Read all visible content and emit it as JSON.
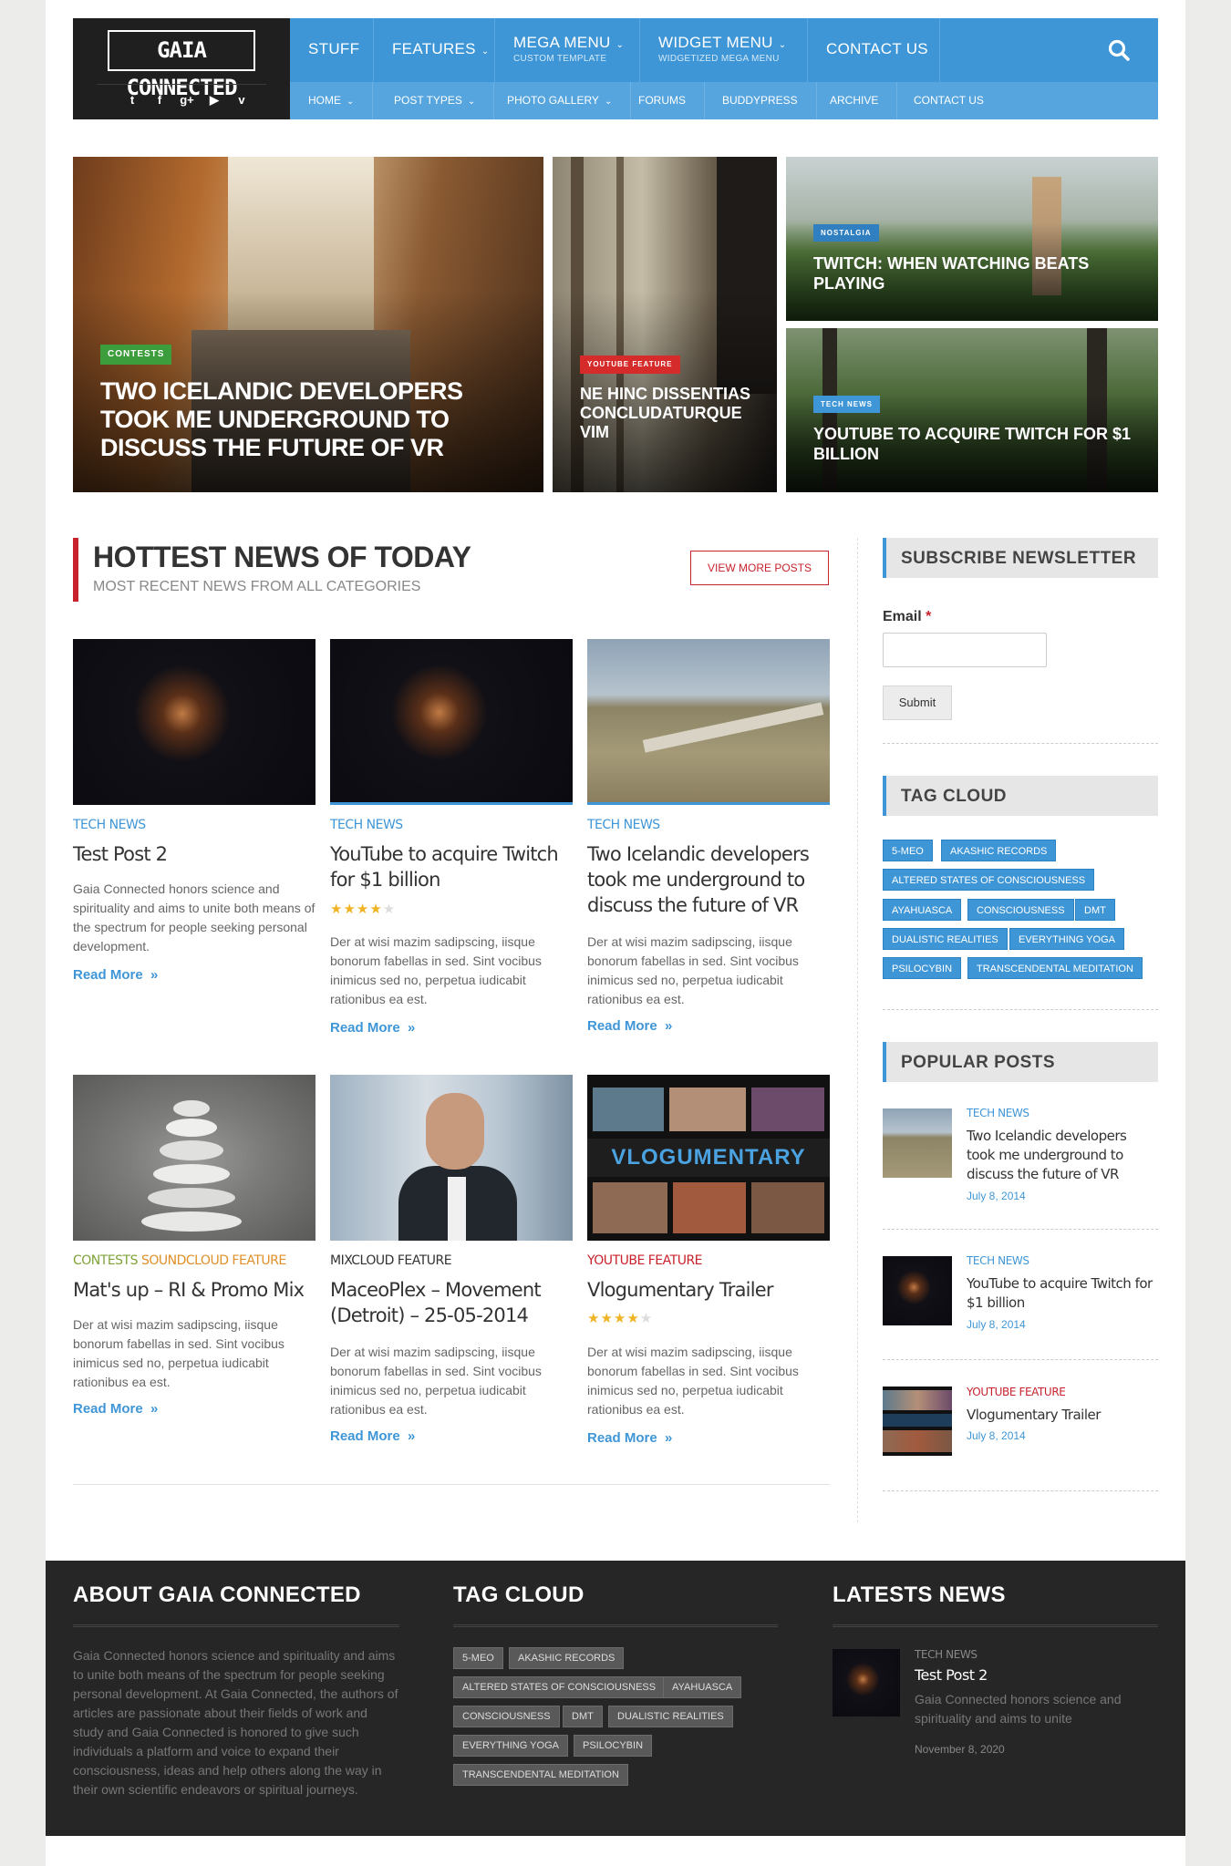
{
  "header": {
    "logo_text": "GAIA CONNECTED",
    "social_icons": [
      "twitter-icon",
      "facebook-icon",
      "google-plus-icon",
      "youtube-icon",
      "vimeo-icon"
    ],
    "social_glyphs": [
      "t",
      "f",
      "g+",
      "▶",
      "v"
    ],
    "main_nav": [
      {
        "label": "STUFF",
        "sub": ""
      },
      {
        "label": "FEATURES",
        "sub": ""
      },
      {
        "label": "MEGA MENU",
        "sub": "CUSTOM TEMPLATE"
      },
      {
        "label": "WIDGET MENU",
        "sub": "WIDGETIZED MEGA MENU"
      },
      {
        "label": "CONTACT US",
        "sub": ""
      }
    ],
    "sub_nav": [
      "HOME",
      "POST TYPES",
      "PHOTO GALLERY",
      "FORUMS",
      "BUDDYPRESS",
      "ARCHIVE",
      "CONTACT US"
    ],
    "search_icon": "search-icon"
  },
  "featured": [
    {
      "tag": "CONTESTS",
      "title": "TWO ICELANDIC DEVELOPERS TOOK ME UNDERGROUND TO DISCUSS THE FUTURE OF VR",
      "tag_color": "#3c9d3c"
    },
    {
      "tag": "YOUTUBE FEATURE",
      "title": "NE HINC DISSENTIAS CONCLUDATURQUE VIM",
      "tag_color": "#d52b2b"
    },
    {
      "tag": "NOSTALGIA",
      "title": "TWITCH: WHEN WATCHING BEATS PLAYING",
      "tag_color": "#2f7fc1"
    },
    {
      "tag": "TECH NEWS",
      "title": "YOUTUBE TO ACQUIRE TWITCH FOR $1 BILLION",
      "tag_color": "#3f96d6"
    }
  ],
  "hottest": {
    "title": "HOTTEST NEWS OF TODAY",
    "subtitle": "MOST RECENT NEWS FROM ALL CATEGORIES",
    "view_more": "VIEW MORE POSTS"
  },
  "posts": [
    {
      "cat": "TECH NEWS",
      "cat2": "",
      "title": "Test Post 2",
      "rating": null,
      "excerpt": "Gaia Connected honors science and spirituality and aims to unite both means of the spectrum for people seeking personal development.",
      "read_more": "Read More"
    },
    {
      "cat": "TECH NEWS",
      "cat2": "",
      "title": "YouTube to acquire Twitch for $1 billion",
      "rating": 4,
      "excerpt": "Der at wisi mazim sadipscing, iisque bonorum fabellas in sed. Sint vocibus inimicus sed no, perpetua iudicabit rationibus ea est.",
      "read_more": "Read More"
    },
    {
      "cat": "TECH NEWS",
      "cat2": "",
      "title": "Two Icelandic developers took me underground to discuss the future of VR",
      "rating": null,
      "excerpt": "Der at wisi mazim sadipscing, iisque bonorum fabellas in sed. Sint vocibus inimicus sed no, perpetua iudicabit rationibus ea est.",
      "read_more": "Read More"
    },
    {
      "cat": "CONTESTS",
      "cat2": "SOUNDCLOUD FEATURE",
      "title": "Mat's up – RI & Promo Mix",
      "rating": null,
      "excerpt": "Der at wisi mazim sadipscing, iisque bonorum fabellas in sed. Sint vocibus inimicus sed no, perpetua iudicabit rationibus ea est.",
      "read_more": "Read More"
    },
    {
      "cat": "MIXCLOUD FEATURE",
      "cat2": "",
      "title": "MaceoPlex – Movement (Detroit) – 25-05-2014",
      "rating": null,
      "excerpt": "Der at wisi mazim sadipscing, iisque bonorum fabellas in sed. Sint vocibus inimicus sed no, perpetua iudicabit rationibus ea est.",
      "read_more": "Read More"
    },
    {
      "cat": "YOUTUBE FEATURE",
      "cat2": "",
      "title": "Vlogumentary Trailer",
      "rating": 4,
      "excerpt": "Der at wisi mazim sadipscing, iisque bonorum fabellas in sed. Sint vocibus inimicus sed no, perpetua iudicabit rationibus ea est.",
      "read_more": "Read More"
    }
  ],
  "vlog_banner": "VLOGUMENTARY",
  "sidebar": {
    "newsletter_title": "SUBSCRIBE NEWSLETTER",
    "email_label": "Email",
    "required_mark": "*",
    "submit_label": "Submit",
    "tagcloud_title": "TAG CLOUD",
    "tags": [
      "5-MEO",
      "AKASHIC RECORDS",
      "ALTERED STATES OF CONSCIOUSNESS",
      "AYAHUASCA",
      "CONSCIOUSNESS",
      "DMT",
      "DUALISTIC REALITIES",
      "EVERYTHING YOGA",
      "PSILOCYBIN",
      "TRANSCENDENTAL MEDITATION"
    ],
    "popular_title": "POPULAR POSTS",
    "popular": [
      {
        "cat": "TECH NEWS",
        "title": "Two Icelandic developers took me underground to discuss the future of VR",
        "date": "July 8, 2014"
      },
      {
        "cat": "TECH NEWS",
        "title": "YouTube to acquire Twitch for $1 billion",
        "date": "July 8, 2014"
      },
      {
        "cat": "YOUTUBE FEATURE",
        "title": "Vlogumentary Trailer",
        "date": "July 8, 2014"
      }
    ]
  },
  "footer": {
    "about_title": "ABOUT GAIA CONNECTED",
    "about_text": "Gaia Connected honors science and spirituality and aims to unite both means of the spectrum for people seeking personal development. At Gaia Connected, the authors of articles are passionate about their fields of work and study and Gaia Connected is honored to give such individuals a platform and voice to expand their consciousness, ideas and help others along the way in their own scientific endeavors or spiritual journeys.",
    "tagcloud_title": "TAG CLOUD",
    "tags": [
      "5-MEO",
      "AKASHIC RECORDS",
      "ALTERED STATES OF CONSCIOUSNESS",
      "AYAHUASCA",
      "CONSCIOUSNESS",
      "DMT",
      "DUALISTIC REALITIES",
      "EVERYTHING YOGA",
      "PSILOCYBIN",
      "TRANSCENDENTAL MEDITATION"
    ],
    "latest_title": "LATESTS NEWS",
    "latest": {
      "cat": "TECH NEWS",
      "title": "Test Post 2",
      "excerpt": "Gaia Connected honors science and spirituality and aims to unite",
      "date": "November 8, 2020"
    }
  },
  "colors": {
    "accent_blue": "#3f96d6",
    "accent_red": "#c8232c",
    "category_orange": "#e0902a",
    "footer_bg": "#262626"
  }
}
